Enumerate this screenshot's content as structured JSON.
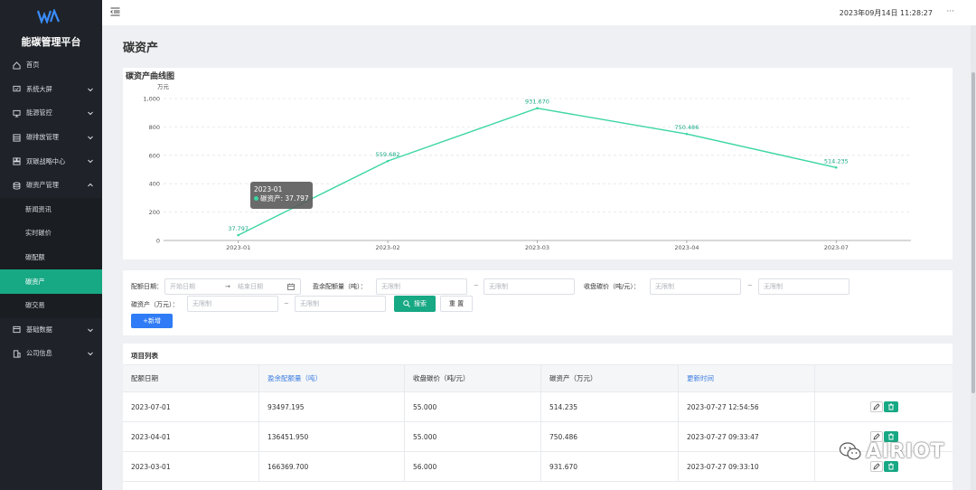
{
  "sidebar": {
    "brand": "能碳管理平台",
    "items": [
      {
        "label": "首页",
        "icon": "home-icon"
      },
      {
        "label": "系统大屏",
        "icon": "screen-icon"
      },
      {
        "label": "能源管控",
        "icon": "monitor-icon"
      },
      {
        "label": "碳排放管理",
        "icon": "emission-icon"
      },
      {
        "label": "双碳战略中心",
        "icon": "strategy-icon"
      },
      {
        "label": "碳资产管理",
        "icon": "database-icon"
      },
      {
        "label": "新闻资讯"
      },
      {
        "label": "实时碳价"
      },
      {
        "label": "碳配额"
      },
      {
        "label": "碳资产"
      },
      {
        "label": "碳交易"
      },
      {
        "label": "基础数据",
        "icon": "data-icon"
      },
      {
        "label": "公司信息",
        "icon": "company-icon"
      }
    ]
  },
  "header": {
    "datetime": "2023年09月14日 11:28:27",
    "more": "···"
  },
  "page_title": "碳资产",
  "chart": {
    "title": "碳资产曲线图",
    "tooltip_title": "2023-01",
    "tooltip_label": "碳资产: 37.797"
  },
  "chart_data": {
    "type": "line",
    "x": [
      "2023-01",
      "2023-02",
      "2023-03",
      "2023-04",
      "2023-07"
    ],
    "series": [
      {
        "name": "碳资产",
        "values": [
          37.797,
          559.682,
          931.67,
          750.486,
          514.235
        ],
        "labels": [
          "37.797",
          "559.682",
          "931.670",
          "750.486",
          "514.235"
        ]
      }
    ],
    "ylabel": "万元",
    "ylim": [
      0,
      1000
    ],
    "yticks": [
      "0",
      "200",
      "400",
      "600",
      "800",
      "1,000"
    ],
    "grid": true,
    "color": "#3dd6a5"
  },
  "filter": {
    "date_label": "配额日期：",
    "date_start_placeholder": "开始日期",
    "date_end_placeholder": "结束日期",
    "quota_label": "盈余配额量（吨）：",
    "price_label": "收盘碳价（吨/元）：",
    "asset_label": "碳资产（万元）：",
    "unlimited": "无限制",
    "tilde": "~",
    "search_label": "搜索",
    "reset_label": "重 置",
    "add_label": "+新增"
  },
  "table": {
    "title": "项目列表",
    "columns": [
      "配额日期",
      "盈余配额量（吨）",
      "收盘碳价（吨/元）",
      "碳资产（万元）",
      "更新时间",
      ""
    ],
    "rows": [
      [
        "2023-07-01",
        "93497.195",
        "55.000",
        "514.235",
        "2023-07-27 12:54:56"
      ],
      [
        "2023-04-01",
        "136451.950",
        "55.000",
        "750.486",
        "2023-07-27 09:33:47"
      ],
      [
        "2023-03-01",
        "166369.700",
        "56.000",
        "931.670",
        "2023-07-27 09:33:10"
      ]
    ]
  },
  "watermark": "AIRIOT"
}
